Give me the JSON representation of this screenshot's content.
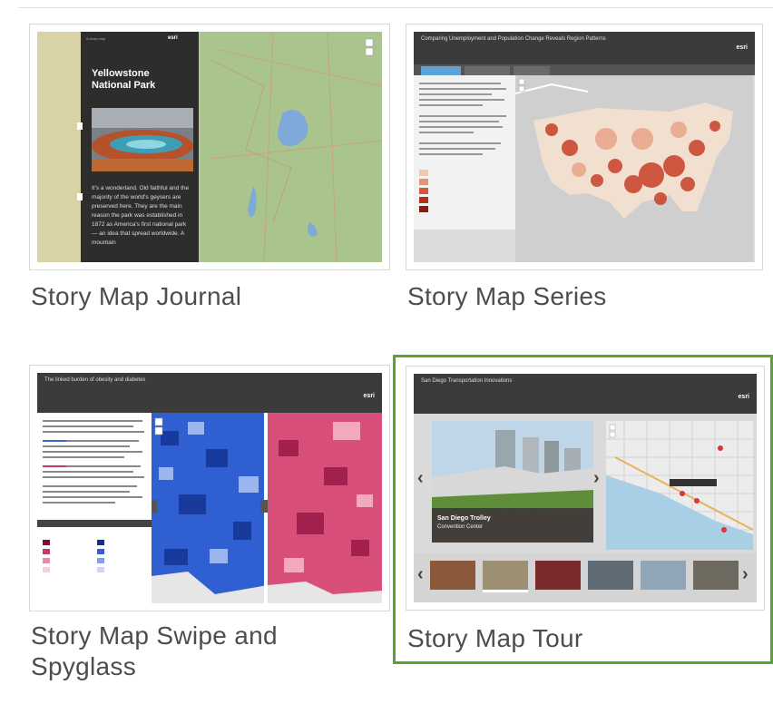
{
  "gallery": {
    "items": [
      {
        "label": "Story Map Journal",
        "thumb": {
          "side_title": "Yellowstone National Park",
          "side_text": "It's a wonderland. Old faithful and the majority of the world's geysers are preserved here. They are the main reason the park was established in 1872 as America's first national park — an idea that spread worldwide. A mountain",
          "topbar": "A story map",
          "brand": "esri"
        }
      },
      {
        "label": "Story Map Series",
        "thumb": {
          "title": "Comparing Unemployment and Population Change Reveals Region Patterns",
          "brand": "esri"
        }
      },
      {
        "label": "Story Map Swipe and Spyglass",
        "thumb": {
          "title": "The linked burden of obesity and diabetes",
          "brand": "esri"
        }
      },
      {
        "label": "Story Map Tour",
        "selected": true,
        "thumb": {
          "title": "San Diego Transportation Innovations",
          "caption_title": "San Diego Trolley",
          "caption_sub": "Convention Center",
          "brand": "esri"
        }
      }
    ]
  },
  "colors": {
    "selected_border": "#59a32c",
    "header_dark": "#3b3b3b",
    "map_green": "#a9c48d",
    "choropleth_red": "#c8402a",
    "swipe_blue": "#2f5fd0",
    "swipe_pink": "#d8507a"
  },
  "icons": {
    "prev": "‹",
    "next": "›"
  }
}
